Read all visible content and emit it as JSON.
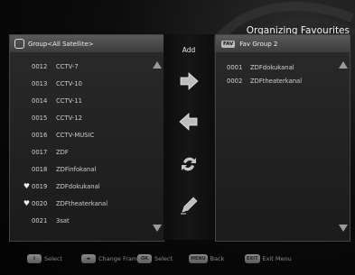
{
  "title": "Organizing Favourites",
  "left_panel": {
    "group_label": "Group<All Satellite>",
    "channels": [
      {
        "number": "0012",
        "name": "CCTV-7",
        "favorite": false
      },
      {
        "number": "0013",
        "name": "CCTV-10",
        "favorite": false
      },
      {
        "number": "0014",
        "name": "CCTV-11",
        "favorite": false
      },
      {
        "number": "0015",
        "name": "CCTV-12",
        "favorite": false
      },
      {
        "number": "0016",
        "name": "CCTV-MUSIC",
        "favorite": false
      },
      {
        "number": "0017",
        "name": "ZDF",
        "favorite": false
      },
      {
        "number": "0018",
        "name": "ZDFinfokanal",
        "favorite": false
      },
      {
        "number": "0019",
        "name": "ZDFdokukanal",
        "favorite": true
      },
      {
        "number": "0020",
        "name": "ZDFtheaterkanal",
        "favorite": true
      },
      {
        "number": "0021",
        "name": "3sat",
        "favorite": false
      }
    ]
  },
  "middle": {
    "add_label": "Add",
    "buttons": [
      "arrow-right-icon",
      "arrow-left-icon",
      "swap-icon",
      "edit-icon"
    ]
  },
  "right_panel": {
    "badge": "FAV",
    "group_label": "Fav Group 2",
    "channels": [
      {
        "number": "0001",
        "name": "ZDFdokukanal"
      },
      {
        "number": "0002",
        "name": "ZDFtheaterkanal"
      }
    ]
  },
  "footer": {
    "select_key": "⇕",
    "select_label": "Select",
    "change_key": "◂▸",
    "change_label": "Change Fram",
    "ok_key": "OK",
    "ok_label": "Select",
    "menu_key": "MENU",
    "menu_label": "Back",
    "exit_key": "EXIT",
    "exit_label": "Exit Menu"
  }
}
